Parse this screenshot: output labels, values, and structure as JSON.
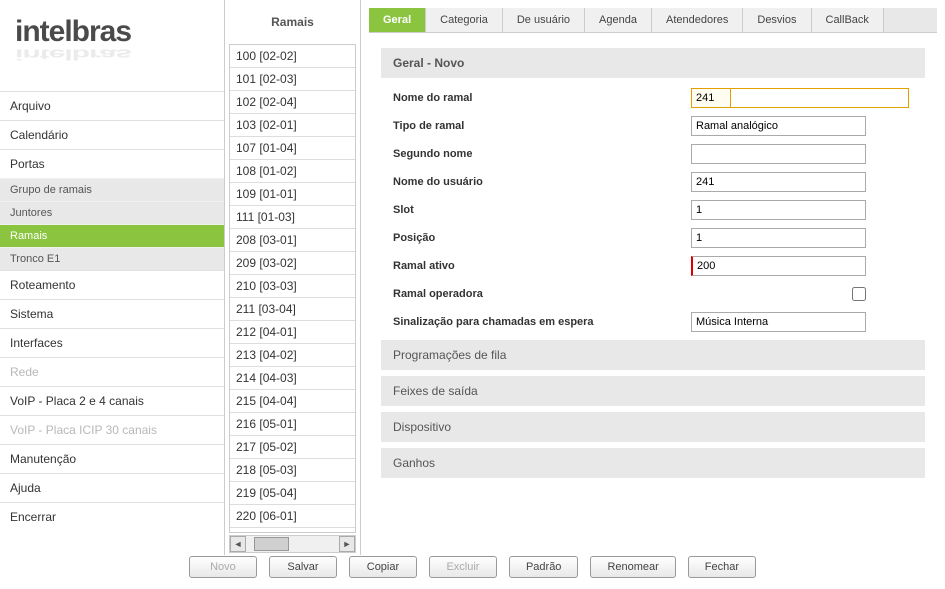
{
  "logo": "intelbras",
  "nav": {
    "arquivo": "Arquivo",
    "calendario": "Calendário",
    "portas": "Portas",
    "portas_items": {
      "grupo": "Grupo de ramais",
      "juntores": "Juntores",
      "ramais": "Ramais",
      "tronco": "Tronco E1"
    },
    "roteamento": "Roteamento",
    "sistema": "Sistema",
    "interfaces": "Interfaces",
    "rede": "Rede",
    "voip24": "VoIP - Placa 2 e 4 canais",
    "voip30": "VoIP - Placa ICIP 30 canais",
    "manutencao": "Manutenção",
    "ajuda": "Ajuda",
    "encerrar": "Encerrar"
  },
  "ramais": {
    "header": "Ramais",
    "items": [
      "100 [02-02]",
      "101 [02-03]",
      "102 [02-04]",
      "103 [02-01]",
      "107 [01-04]",
      "108 [01-02]",
      "109 [01-01]",
      "111 [01-03]",
      "208 [03-01]",
      "209 [03-02]",
      "210 [03-03]",
      "211 [03-04]",
      "212 [04-01]",
      "213 [04-02]",
      "214 [04-03]",
      "215 [04-04]",
      "216 [05-01]",
      "217 [05-02]",
      "218 [05-03]",
      "219 [05-04]",
      "220 [06-01]"
    ],
    "hscroll_marker": "III"
  },
  "tabs": [
    "Geral",
    "Categoria",
    "De usuário",
    "Agenda",
    "Atendedores",
    "Desvios",
    "CallBack"
  ],
  "form": {
    "section_title": "Geral - Novo",
    "labels": {
      "nome_ramal": "Nome do ramal",
      "tipo_ramal": "Tipo de ramal",
      "segundo_nome": "Segundo nome",
      "nome_usuario": "Nome do usuário",
      "slot": "Slot",
      "posicao": "Posição",
      "ramal_ativo": "Ramal ativo",
      "ramal_operadora": "Ramal operadora",
      "sinalizacao": "Sinalização para chamadas em espera"
    },
    "values": {
      "nome_ramal": "241",
      "tipo_ramal": "Ramal analógico",
      "segundo_nome": "",
      "nome_usuario": "241",
      "slot": "1",
      "posicao": "1",
      "ramal_ativo": "200",
      "sinalizacao": "Música Interna"
    },
    "collapsed": {
      "prog_fila": "Programações de fila",
      "feixes": "Feixes de saída",
      "dispositivo": "Dispositivo",
      "ganhos": "Ganhos"
    }
  },
  "buttons": {
    "novo": "Novo",
    "salvar": "Salvar",
    "copiar": "Copiar",
    "excluir": "Excluir",
    "padrao": "Padrão",
    "renomear": "Renomear",
    "fechar": "Fechar"
  }
}
